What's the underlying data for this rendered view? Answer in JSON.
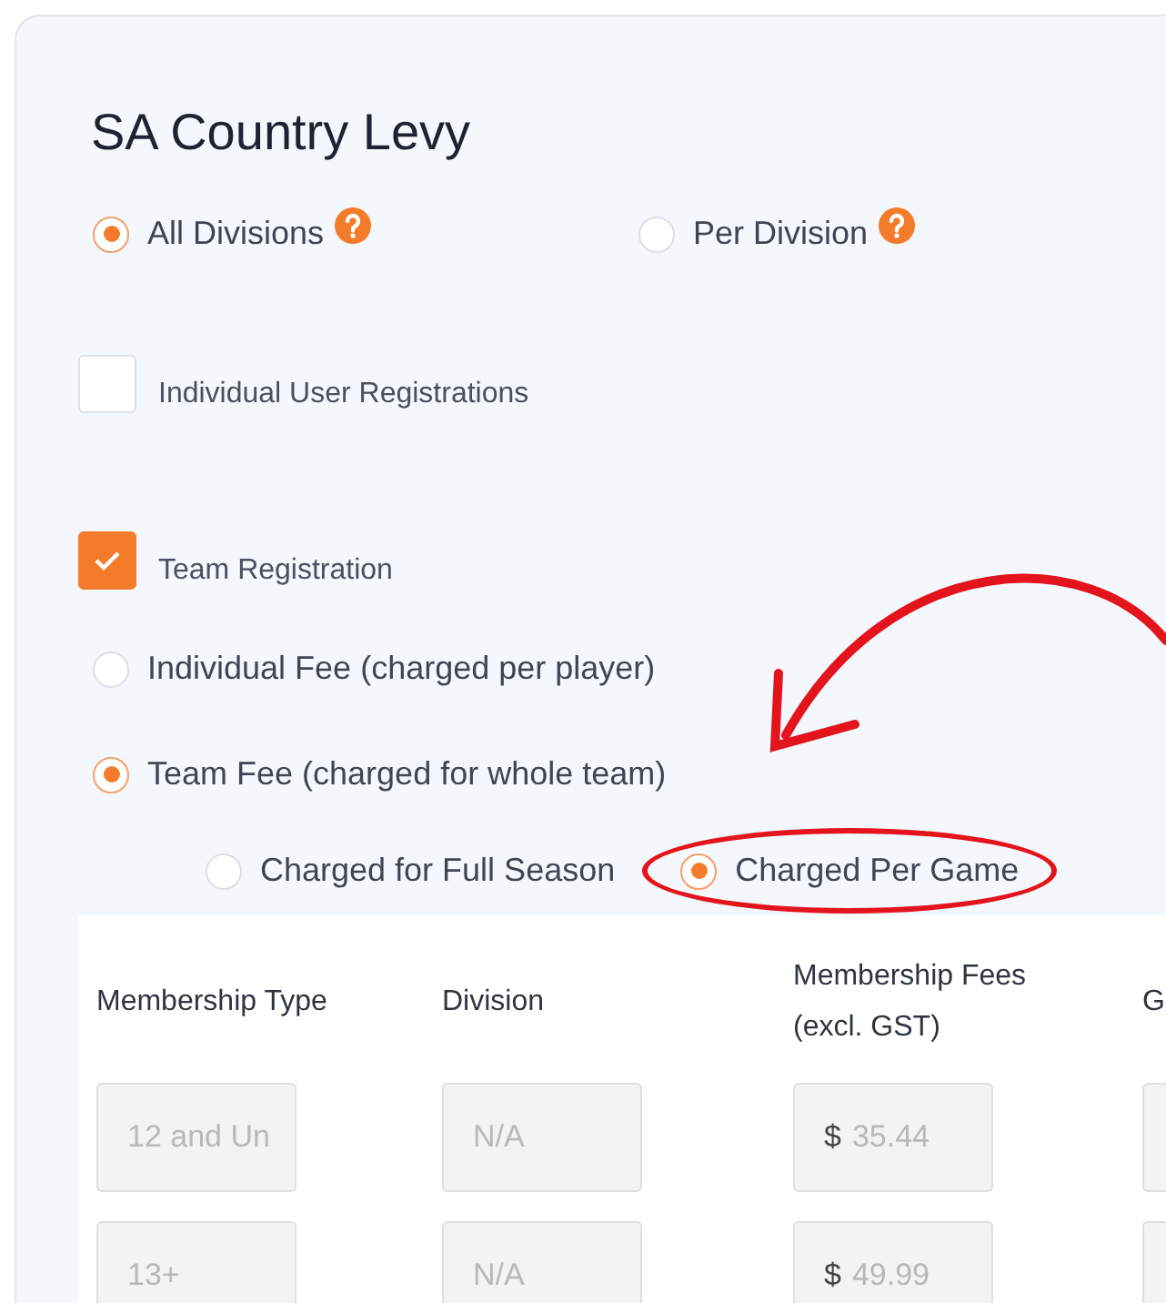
{
  "title": "SA Country Levy",
  "scope_options": [
    {
      "label": "All Divisions",
      "selected": true,
      "help": true
    },
    {
      "label": "Per Division",
      "selected": false,
      "help": true
    }
  ],
  "registrations": [
    {
      "label": "Individual User Registrations",
      "checked": false
    },
    {
      "label": "Team Registration",
      "checked": true
    }
  ],
  "fee_options": [
    {
      "label": "Individual Fee (charged per player)",
      "selected": false
    },
    {
      "label": "Team Fee (charged for whole team)",
      "selected": true,
      "children": [
        {
          "label": "Charged for Full Season",
          "selected": false,
          "highlighted": false
        },
        {
          "label": "Charged Per Game",
          "selected": true,
          "highlighted": true
        }
      ]
    }
  ],
  "table": {
    "columns": [
      "Membership Type",
      "Division",
      "Membership Fees (excl. GST)",
      "G"
    ],
    "rows": [
      {
        "membership_type": "12 and Un",
        "division": "N/A",
        "currency": "$",
        "fee": "35.44"
      },
      {
        "membership_type": "13+",
        "division": "N/A",
        "currency": "$",
        "fee": "49.99"
      }
    ]
  }
}
